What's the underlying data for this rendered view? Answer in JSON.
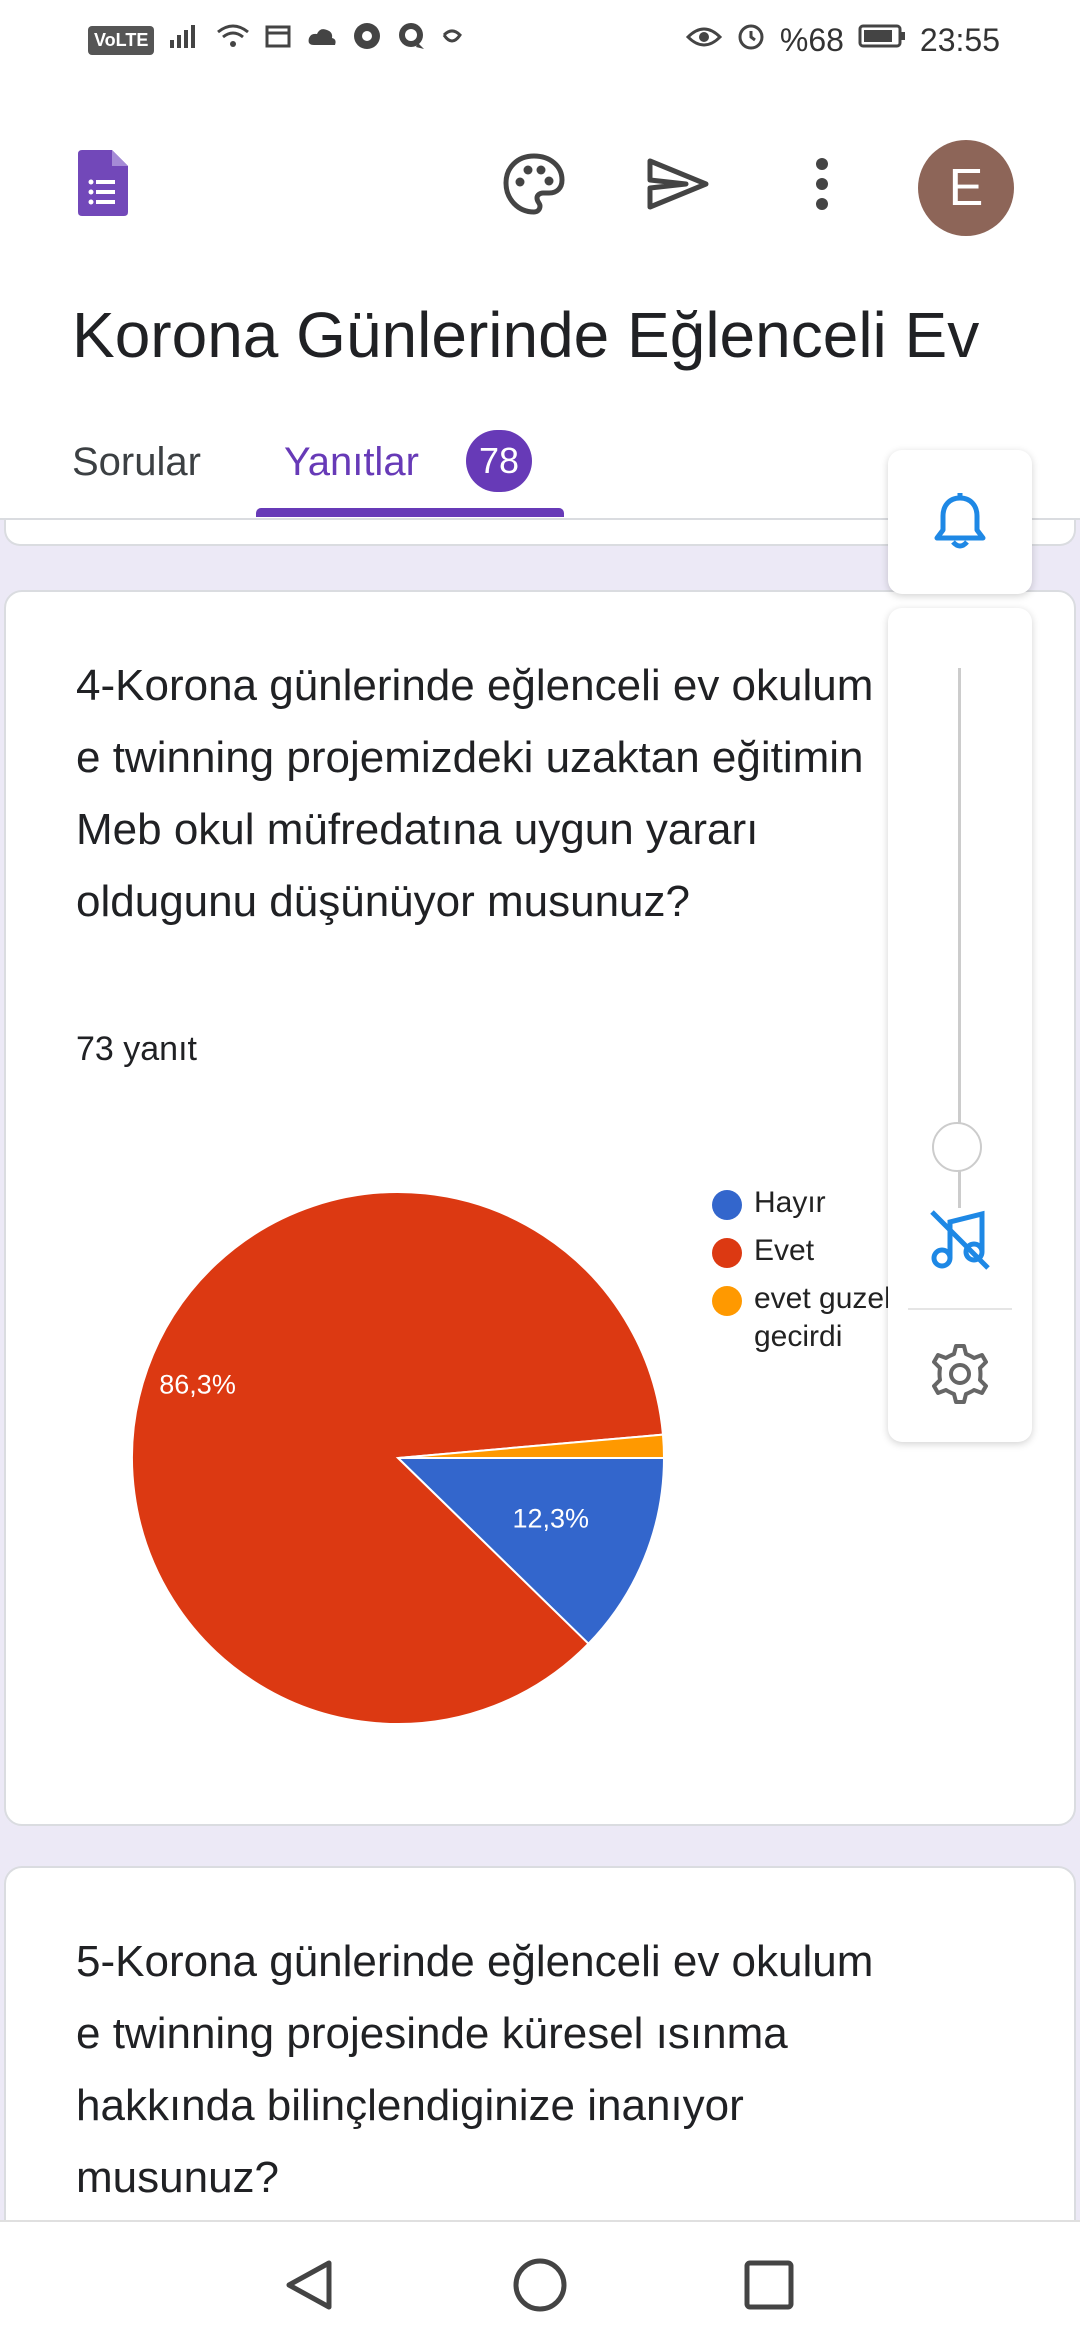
{
  "status_bar": {
    "volte": "VoLTE",
    "battery": "%68",
    "time": "23:55"
  },
  "header": {
    "form_title": "Korona Günlerinde Eğlenceli Ev",
    "avatar_letter": "E",
    "icons": [
      "forms-logo-icon",
      "palette-icon",
      "send-icon",
      "more-vert-icon"
    ]
  },
  "tabs": {
    "questions": "Sorular",
    "responses": "Yanıtlar",
    "response_count": "78"
  },
  "question4": {
    "text": "4-Korona günlerinde eğlenceli ev okulum e twinning projemizdeki uzaktan eğitimin Meb okul müfredatına uygun yararı oldugunu düşünüyor musunuz?",
    "response_count": "73 yanıt"
  },
  "chart_data": {
    "type": "pie",
    "slices": [
      {
        "label": "Hayır",
        "value": 12.3,
        "color": "#3366cc",
        "data_label": "12,3%"
      },
      {
        "label": "Evet",
        "value": 86.3,
        "color": "#dc3912",
        "data_label": "86,3%"
      },
      {
        "label": "evet guzel gecirdi",
        "value": 1.4,
        "color": "#ff9900",
        "data_label": ""
      }
    ]
  },
  "question5": {
    "text": "5-Korona günlerinde eğlenceli ev okulum e twinning projesinde küresel ısınma hakkında bilinçlendiginize inanıyor musunuz?"
  },
  "floating_panel": {
    "icons": [
      "bell-icon",
      "music-off-icon",
      "settings-icon"
    ],
    "volume_level": 0.05
  },
  "nav": {
    "icons": [
      "back-icon",
      "home-icon",
      "recents-icon"
    ]
  },
  "colors": {
    "accent": "#673ab7",
    "background": "#ece9f6"
  }
}
